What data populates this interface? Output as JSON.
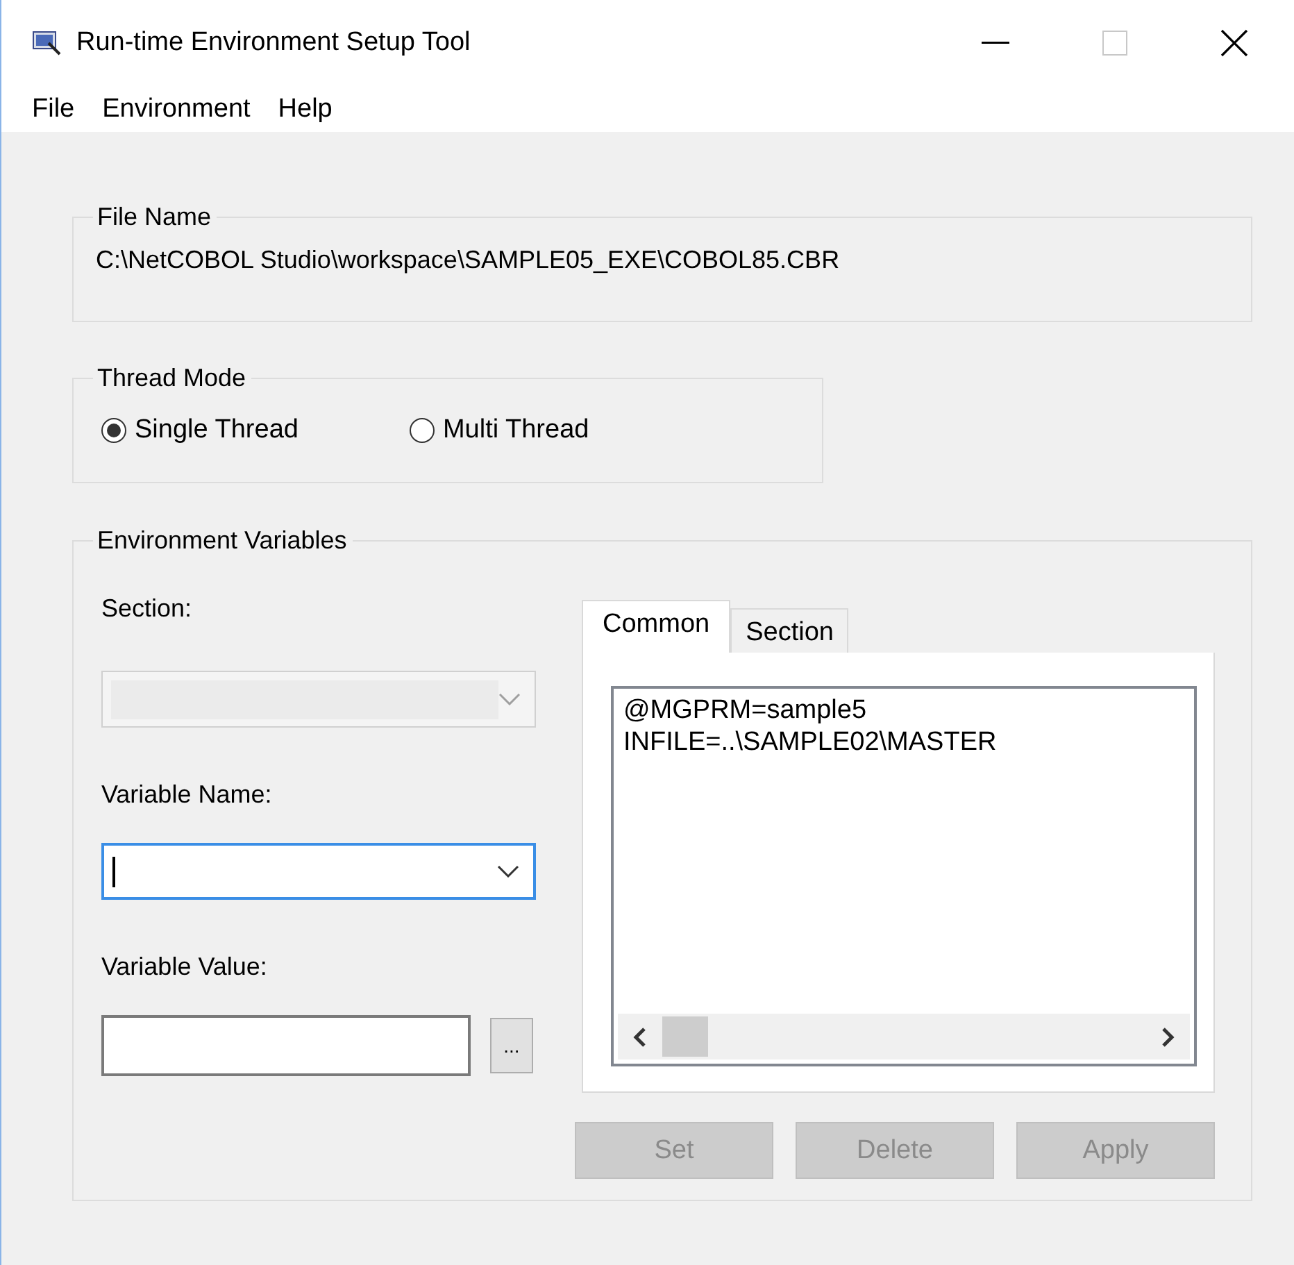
{
  "window": {
    "title": "Run-time Environment Setup Tool",
    "maximize_disabled": true
  },
  "menu": [
    {
      "label": "File"
    },
    {
      "label": "Environment"
    },
    {
      "label": "Help"
    }
  ],
  "file_name": {
    "legend": "File Name",
    "path": "C:\\NetCOBOL Studio\\workspace\\SAMPLE05_EXE\\COBOL85.CBR"
  },
  "thread_mode": {
    "legend": "Thread Mode",
    "options": [
      {
        "label": "Single Thread",
        "selected": true
      },
      {
        "label": "Multi Thread",
        "selected": false
      }
    ]
  },
  "environment_variables": {
    "legend": "Environment Variables",
    "section": {
      "label": "Section:",
      "disabled": true,
      "focused": false
    },
    "variable_name": {
      "label": "Variable Name:",
      "disabled": false,
      "focused": true
    },
    "variable_value": {
      "label": "Variable Value:",
      "browse": "..."
    },
    "tabs": [
      {
        "label": "Common",
        "selected": true
      },
      {
        "label": "Section",
        "selected": false
      }
    ],
    "entries": [
      "@MGPRM=sample5",
      "INFILE=..\\SAMPLE02\\MASTER"
    ],
    "buttons": [
      {
        "label": "Set",
        "disabled": true
      },
      {
        "label": "Delete",
        "disabled": true
      },
      {
        "label": "Apply",
        "disabled": true
      }
    ]
  }
}
